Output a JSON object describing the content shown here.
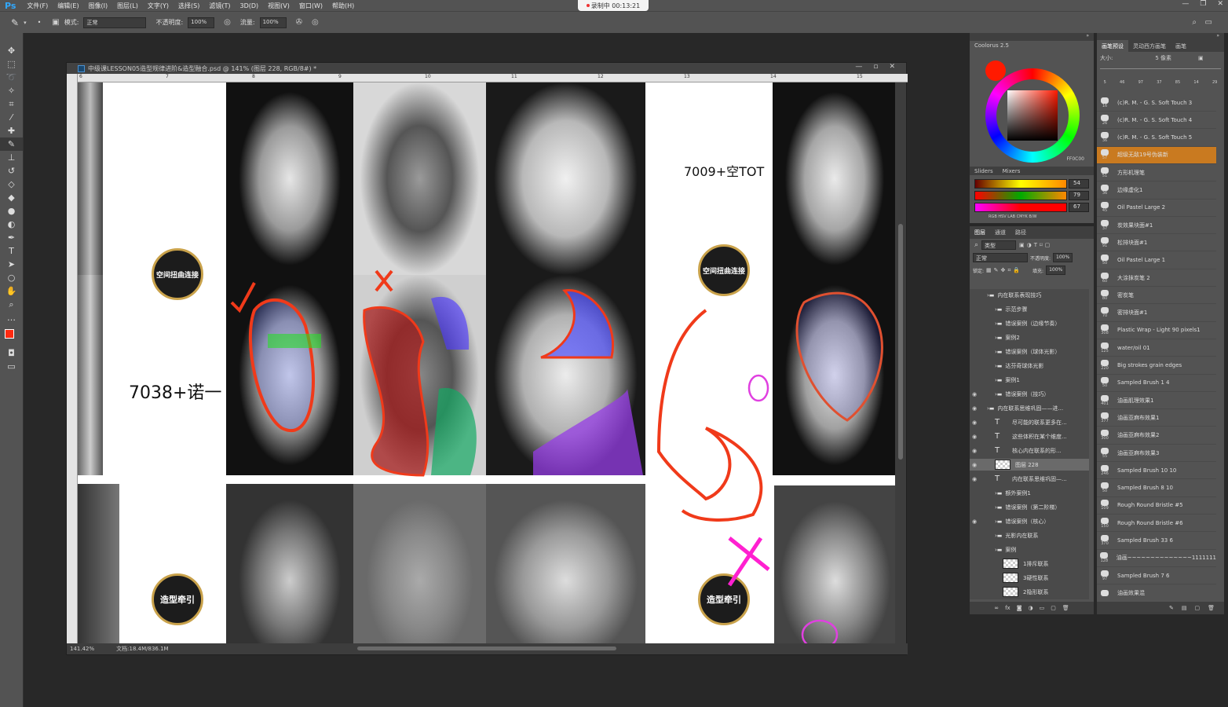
{
  "app": {
    "logo": "Ps"
  },
  "menu": [
    "文件(F)",
    "编辑(E)",
    "图像(I)",
    "图层(L)",
    "文字(Y)",
    "选择(S)",
    "滤镜(T)",
    "3D(D)",
    "视图(V)",
    "窗口(W)",
    "帮助(H)"
  ],
  "recording": {
    "text": "录制中 00:13:21"
  },
  "options": {
    "mode_label": "模式:",
    "mode_value": "正常",
    "opacity_label": "不透明度:",
    "opacity_value": "100%",
    "flow_label": "流量:",
    "flow_value": "100%"
  },
  "document": {
    "title": "中级课LESSON05造型规律进阶&造型融合.psd @ 141% (图层 228, RGB/8#) *",
    "ruler_top": [
      "6",
      "7",
      "8",
      "9",
      "10",
      "11",
      "12",
      "13",
      "14",
      "15"
    ],
    "status_zoom": "141.42%",
    "status_doc": "文档:18.4M/836.1M"
  },
  "canvas": {
    "badge_1": "空间扭曲连接",
    "badge_2": "空间扭曲连接",
    "badge_3": "造型牵引",
    "badge_4": "造型牵引",
    "label_left": "7038+诺一",
    "label_right": "7009+空TOT"
  },
  "color_panel": {
    "title": "Coolorus 2.5",
    "hex": "FF0C00",
    "tab_sliders": "Sliders",
    "tab_mixers": "Mixers",
    "r": "54",
    "g": "79",
    "b": "67",
    "modes": "RGB HSV LAB CMYK B/W",
    "accent": "#ff2a10"
  },
  "layers_panel": {
    "tabs": [
      "图层",
      "通道",
      "路径"
    ],
    "filter_label": "类型",
    "blend_mode": "正常",
    "opacity_label": "不透明度:",
    "opacity_value": "100%",
    "lock_label": "锁定:",
    "fill_label": "填充:",
    "fill_value": "100%",
    "layers": [
      {
        "name": "内在联系表现技巧",
        "type": "group",
        "eye": false,
        "indent": 1
      },
      {
        "name": "示范步骤",
        "type": "group",
        "eye": false,
        "indent": 2
      },
      {
        "name": "错误案例（边缘节奏）",
        "type": "group",
        "eye": false,
        "indent": 2
      },
      {
        "name": "案例2",
        "type": "group",
        "eye": false,
        "indent": 2
      },
      {
        "name": "错误案例（球体光影）",
        "type": "group",
        "eye": false,
        "indent": 2
      },
      {
        "name": "达芬奇球体光影",
        "type": "group",
        "eye": false,
        "indent": 2
      },
      {
        "name": "案例1",
        "type": "group",
        "eye": false,
        "indent": 2
      },
      {
        "name": "错误案例（技巧）",
        "type": "group",
        "eye": true,
        "indent": 2
      },
      {
        "name": "内在联系思维巩固——进...",
        "type": "group",
        "eye": true,
        "indent": 1
      },
      {
        "name": "尽可能的联系更多在...",
        "type": "text",
        "eye": true,
        "indent": 2
      },
      {
        "name": "这些体积在某个维度...",
        "type": "text",
        "eye": true,
        "indent": 2
      },
      {
        "name": "核心内在联系的形...",
        "type": "text",
        "eye": true,
        "indent": 2
      },
      {
        "name": "图层 228",
        "type": "pixel",
        "eye": true,
        "indent": 2,
        "selected": true
      },
      {
        "name": "内在联系思维巩固—...",
        "type": "text",
        "eye": true,
        "indent": 2
      },
      {
        "name": "额外案例1",
        "type": "group",
        "eye": false,
        "indent": 2
      },
      {
        "name": "错误案例（第二阶梯）",
        "type": "group",
        "eye": false,
        "indent": 2
      },
      {
        "name": "错误案例（核心）",
        "type": "group",
        "eye": true,
        "indent": 2
      },
      {
        "name": "光影内在联系",
        "type": "group",
        "eye": false,
        "indent": 2
      },
      {
        "name": "案例",
        "type": "group",
        "eye": false,
        "indent": 2
      },
      {
        "name": "1排斥联系",
        "type": "pixel",
        "eye": false,
        "indent": 3
      },
      {
        "name": "3硬性联系",
        "type": "pixel",
        "eye": false,
        "indent": 3
      },
      {
        "name": "2隐形联系",
        "type": "pixel",
        "eye": false,
        "indent": 3
      }
    ]
  },
  "brush_panel": {
    "tabs": [
      "画笔预设",
      "灵动西方画笔",
      "画笔"
    ],
    "size_label": "大小:",
    "size_value": "5 像素",
    "top_sizes": [
      "5",
      "46",
      "97",
      "37",
      "85",
      "14",
      "29"
    ],
    "brushes": [
      {
        "name": "(c)R. M. - G. S. Soft Touch 3",
        "size": "16"
      },
      {
        "name": "(c)R. M. - G. S. Soft Touch 4",
        "size": "26"
      },
      {
        "name": "(c)R. M. - G. S. Soft Touch 5",
        "size": "36"
      },
      {
        "name": "超级无敌19号伪装新",
        "size": "57",
        "selected": true
      },
      {
        "name": "方形机理笔",
        "size": "51"
      },
      {
        "name": "边缘虚化1",
        "size": "36"
      },
      {
        "name": "Oil Pastel Large 2",
        "size": "45"
      },
      {
        "name": "炭效果块面#1",
        "size": "37"
      },
      {
        "name": "松排块面#1",
        "size": "91"
      },
      {
        "name": "Oil Pastel Large 1",
        "size": "50"
      },
      {
        "name": "大涂抹炭笔 2",
        "size": "60"
      },
      {
        "name": "密炭笔",
        "size": "80"
      },
      {
        "name": "密排块面#1",
        "size": "70"
      },
      {
        "name": "Plastic Wrap - Light 90 pixels1",
        "size": "308"
      },
      {
        "name": "water/oil 01",
        "size": "125"
      },
      {
        "name": "Big strokes grain edges",
        "size": "220"
      },
      {
        "name": "Sampled Brush 1 4",
        "size": "50"
      },
      {
        "name": "油画肌理效果1",
        "size": "401"
      },
      {
        "name": "油画亚麻布效果1",
        "size": "377"
      },
      {
        "name": "油画亚麻布效果2",
        "size": "300"
      },
      {
        "name": "油画亚麻布效果3",
        "size": "55"
      },
      {
        "name": "Sampled Brush 10 10",
        "size": "246"
      },
      {
        "name": "Sampled Brush 8 10",
        "size": "50"
      },
      {
        "name": "Rough Round Bristle #5",
        "size": "109"
      },
      {
        "name": "Rough Round Bristle #6",
        "size": "150"
      },
      {
        "name": "Sampled Brush 33 6",
        "size": "370"
      },
      {
        "name": "油画~~~~~~~~~~~~~~1111111",
        "size": "128"
      },
      {
        "name": "Sampled Brush 7 6",
        "size": "97"
      },
      {
        "name": "油画效果混",
        "size": ""
      }
    ]
  }
}
